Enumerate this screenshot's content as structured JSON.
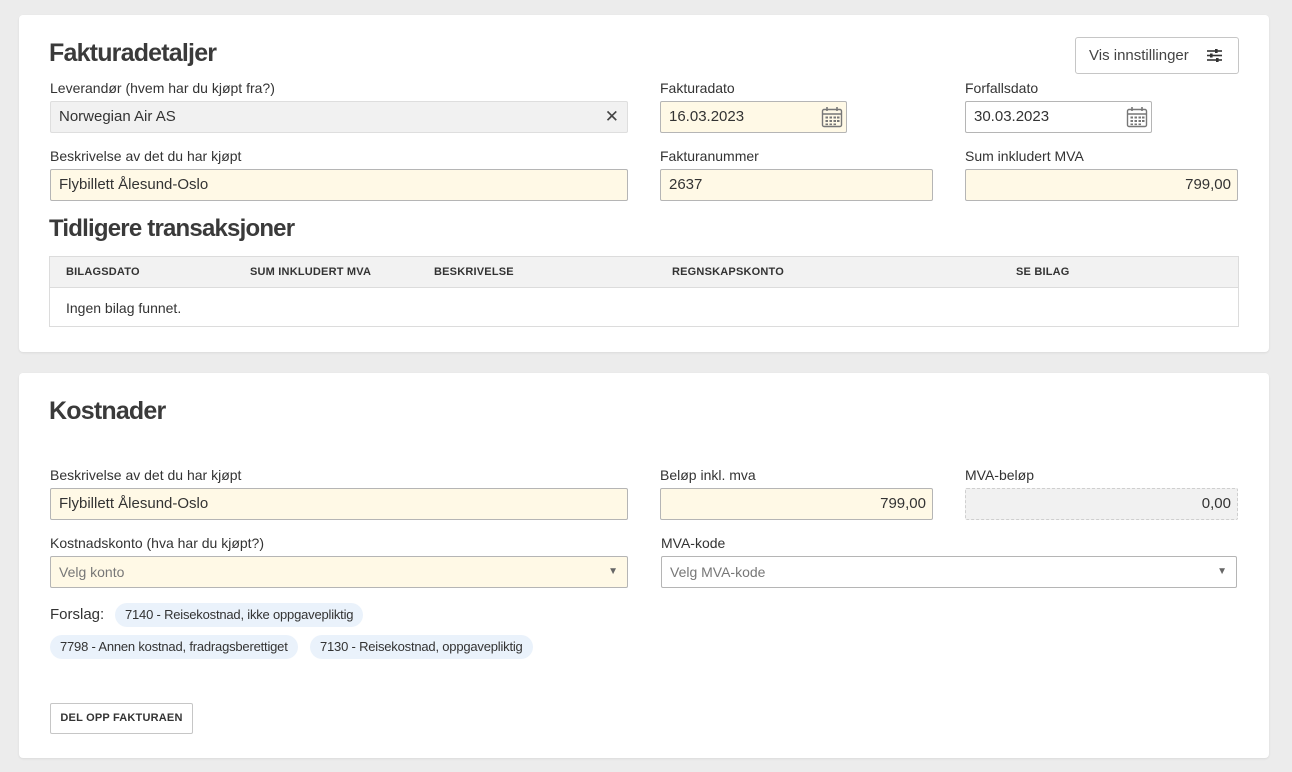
{
  "invoice_details": {
    "title": "Fakturadetaljer",
    "settings_button": "Vis innstillinger",
    "supplier": {
      "label": "Leverandør (hvem har du kjøpt fra?)",
      "value": "Norwegian Air AS"
    },
    "invoice_date": {
      "label": "Fakturadato",
      "value": "16.03.2023"
    },
    "due_date": {
      "label": "Forfallsdato",
      "value": "30.03.2023"
    },
    "description": {
      "label": "Beskrivelse av det du har kjøpt",
      "value": "Flybillett Ålesund-Oslo"
    },
    "invoice_number": {
      "label": "Fakturanummer",
      "value": "2637"
    },
    "total_incl_vat": {
      "label": "Sum inkludert MVA",
      "value": "799,00"
    }
  },
  "previous_transactions": {
    "title": "Tidligere transaksjoner",
    "columns": [
      "BILAGSDATO",
      "SUM INKLUDERT MVA",
      "BESKRIVELSE",
      "REGNSKAPSKONTO",
      "SE BILAG"
    ],
    "empty_message": "Ingen bilag funnet."
  },
  "costs": {
    "title": "Kostnader",
    "description": {
      "label": "Beskrivelse av det du har kjøpt",
      "value": "Flybillett Ålesund-Oslo"
    },
    "amount": {
      "label": "Beløp inkl. mva",
      "value": "799,00"
    },
    "vat_amount": {
      "label": "MVA-beløp",
      "value": "0,00"
    },
    "cost_account": {
      "label": "Kostnadskonto (hva har du kjøpt?)",
      "placeholder": "Velg konto"
    },
    "vat_code": {
      "label": "MVA-kode",
      "placeholder": "Velg MVA-kode"
    },
    "suggestions_label": "Forslag:",
    "suggestions": [
      "7140 - Reisekostnad, ikke oppgavepliktig",
      "7798 - Annen kostnad, fradragsberettiget",
      "7130 - Reisekostnad, oppgavepliktig"
    ],
    "split_button": "DEL OPP FAKTURAEN"
  },
  "icons": [
    "close-icon",
    "calendar-icon",
    "settings-sliders-icon",
    "dropdown-caret-icon"
  ]
}
